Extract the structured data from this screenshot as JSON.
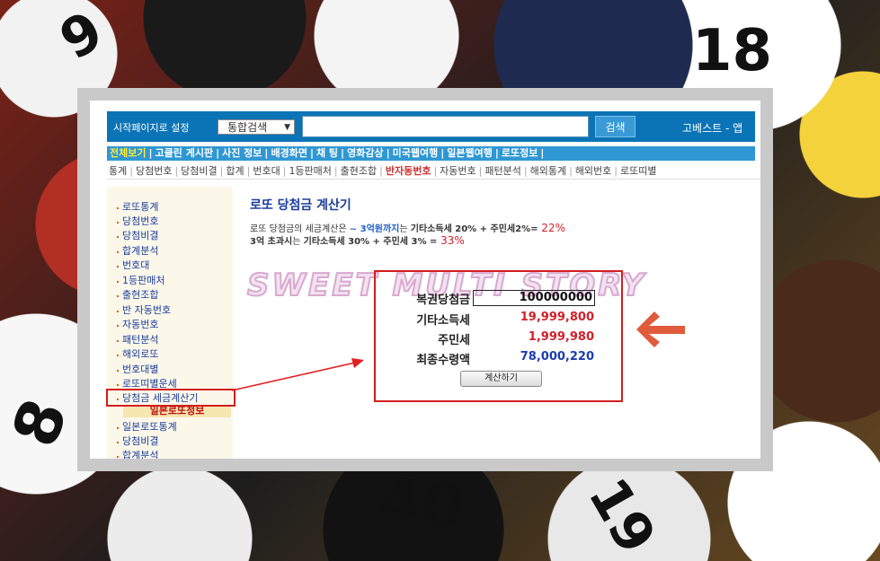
{
  "background": {
    "ball_numbers": [
      "9",
      "18",
      "8",
      "40",
      "19"
    ]
  },
  "topbar": {
    "start_label": "시작페이지로 설정",
    "search_select": "통합검색",
    "search_value": "",
    "search_button": "검색",
    "brand": "고베스트 - 앱"
  },
  "nav1": {
    "items": [
      "전체보기",
      "고클린 게시판",
      "사진 정보",
      "배경화면",
      "채 팅",
      "영화감상",
      "미국웹여행",
      "일본웹여행",
      "로또정보"
    ]
  },
  "nav2": {
    "items": [
      "통계",
      "당첨번호",
      "당첨비결",
      "합계",
      "번호대",
      "1등판매처",
      "출현조합",
      "반자동번호",
      "자동번호",
      "패턴분석",
      "해외통계",
      "해외번호",
      "로또띠별"
    ]
  },
  "sidebar": {
    "items": [
      "로또통계",
      "당첨번호",
      "당첨비결",
      "합계분석",
      "번호대",
      "1등판매처",
      "출현조합",
      "반 자동번호",
      "자동번호",
      "패턴분석",
      "해외로또",
      "번호대별",
      "로또띠별운세",
      "당첨금 세금계산기"
    ],
    "section_title": "일본로또정보",
    "sub_items": [
      "일본로또통계",
      "당첨비결",
      "합계분석"
    ]
  },
  "main": {
    "title": "로또 당첨금 계산기",
    "desc_line1": {
      "a": "로또 당첨금의 세금계산은 ",
      "b": "~ 3억원까지",
      "c": "는 ",
      "d": "기타소득세 20% + 주민세2%=",
      "e": " 22%"
    },
    "desc_line2": {
      "a": "3억 초과시",
      "b": "는 ",
      "c": "기타소득세 30% + 주민세 3% =",
      "d": " 33%"
    },
    "watermark": "SWEET MULTI STORY"
  },
  "calculator": {
    "prize_label": "복권당첨금",
    "prize_value": "100000000",
    "income_tax_label": "기타소득세",
    "income_tax_value": "19,999,800",
    "resident_tax_label": "주민세",
    "resident_tax_value": "1,999,980",
    "final_label": "최종수령액",
    "final_value": "78,000,220",
    "button_label": "계산하기"
  },
  "colors": {
    "topbar": "#0b74b6",
    "nav1": "#2f97d3",
    "highlight_red": "#d21e1e",
    "tax_red": "#d0202a",
    "final_blue": "#1c3cb4",
    "arrow_orange": "#e05a3c"
  }
}
